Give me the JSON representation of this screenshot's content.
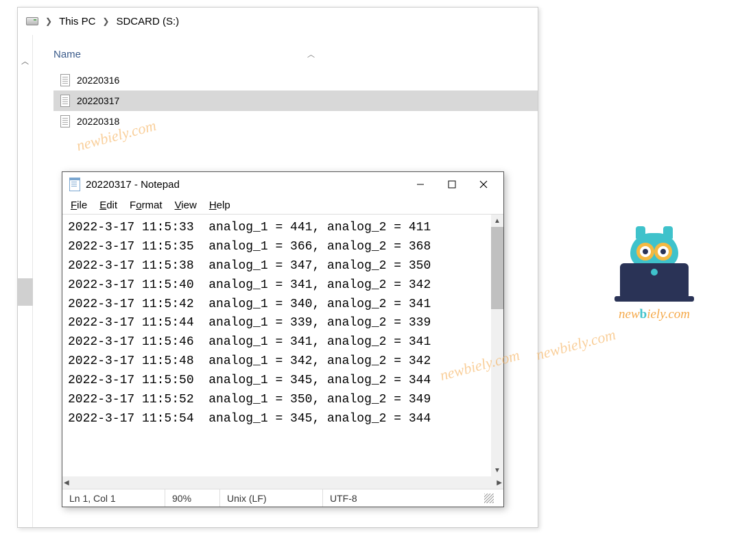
{
  "breadcrumb": {
    "root": "This PC",
    "path": "SDCARD (S:)"
  },
  "columns": {
    "name": "Name"
  },
  "files": [
    {
      "name": "20220316"
    },
    {
      "name": "20220317"
    },
    {
      "name": "20220318"
    }
  ],
  "notepad": {
    "title": "20220317 - Notepad",
    "menu": {
      "file": "File",
      "edit": "Edit",
      "format": "Format",
      "view": "View",
      "help": "Help"
    },
    "lines": [
      "2022-3-17 11:5:33  analog_1 = 441, analog_2 = 411",
      "2022-3-17 11:5:35  analog_1 = 366, analog_2 = 368",
      "2022-3-17 11:5:38  analog_1 = 347, analog_2 = 350",
      "2022-3-17 11:5:40  analog_1 = 341, analog_2 = 342",
      "2022-3-17 11:5:42  analog_1 = 340, analog_2 = 341",
      "2022-3-17 11:5:44  analog_1 = 339, analog_2 = 339",
      "2022-3-17 11:5:46  analog_1 = 341, analog_2 = 341",
      "2022-3-17 11:5:48  analog_1 = 342, analog_2 = 342",
      "2022-3-17 11:5:50  analog_1 = 345, analog_2 = 344",
      "2022-3-17 11:5:52  analog_1 = 350, analog_2 = 349",
      "2022-3-17 11:5:54  analog_1 = 345, analog_2 = 344"
    ],
    "status": {
      "pos": "Ln 1, Col 1",
      "zoom": "90%",
      "eol": "Unix (LF)",
      "enc": "UTF-8"
    }
  },
  "watermarks": {
    "text": "newbiely.com"
  },
  "brand": {
    "prefix": "new",
    "bold": "b",
    "suffix": "iely.com"
  }
}
